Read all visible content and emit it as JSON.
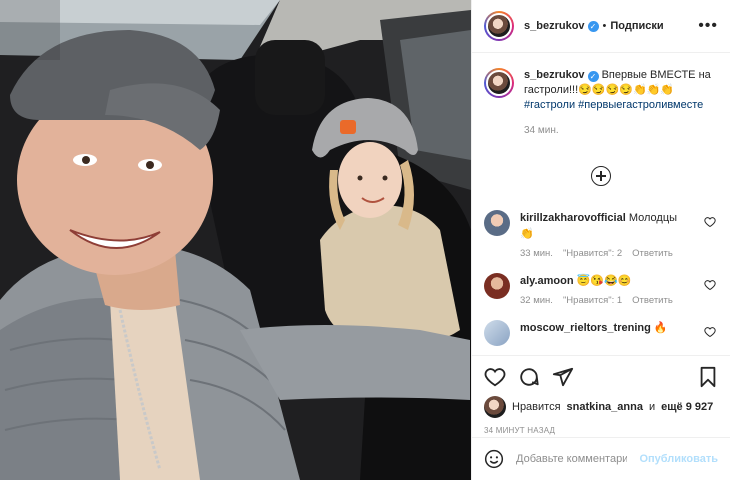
{
  "post": {
    "username": "s_bezrukov",
    "follow_label": "Подписки",
    "dot": "•",
    "more": "•••",
    "caption_text": "Впервые ВМЕСТЕ на гастроли!!!",
    "caption_emoji": "😏😏😏😏👏👏👏",
    "hashtags": [
      "#гастроли",
      "#первыегастроливместе"
    ],
    "caption_time": "34 мин."
  },
  "comments": [
    {
      "user": "kirillzakharovofficial",
      "text": "Молодцы",
      "emoji": "👏",
      "time": "33 мин.",
      "likes": "\"Нравится\": 2",
      "reply": "Ответить",
      "avatar_color": "#7a8ea8"
    },
    {
      "user": "aly.amoon",
      "text": "",
      "emoji": "😇😘😂😊",
      "time": "32 мин.",
      "likes": "\"Нравится\": 1",
      "reply": "Ответить",
      "avatar_color": "#8a3b2e"
    },
    {
      "user": "moscow_rieltors_trening",
      "text": "",
      "emoji": "🔥",
      "time": "",
      "likes": "",
      "reply": "",
      "avatar_color": "#9fb5d0"
    }
  ],
  "likes": {
    "prefix": "Нравится",
    "user": "snatkina_anna",
    "joiner": "и",
    "rest": "ещё 9 927"
  },
  "timestamp": "34 МИНУТ НАЗАД",
  "add_comment": {
    "placeholder": "Добавьте комментарий...",
    "publish": "Опубликовать"
  },
  "icons": [
    "heart-icon",
    "comment-icon",
    "share-icon",
    "bookmark-icon",
    "emoji-icon",
    "more-icon",
    "load-more-icon"
  ],
  "colors": {
    "link": "#00376b",
    "verified": "#3897f0",
    "publish_disabled": "#b2dffc",
    "meta": "#8e8e8e"
  }
}
